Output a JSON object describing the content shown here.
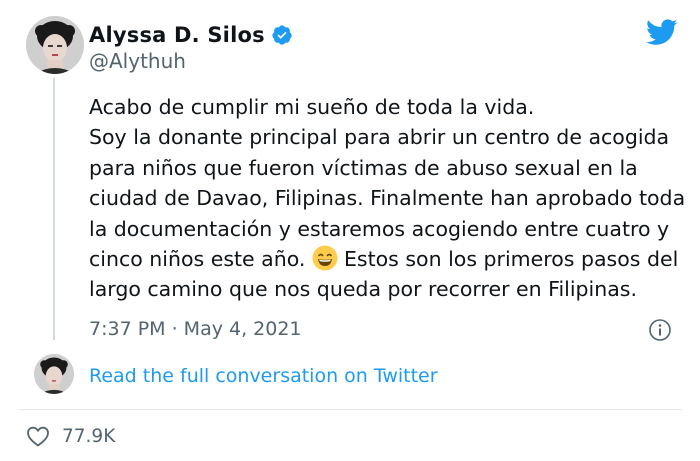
{
  "author": {
    "name": "Alyssa D. Silos",
    "handle": "@Alythuh",
    "verified": true
  },
  "tweet": {
    "text_before_emoji": "Acabo de cumplir mi sueño de toda la vida.\nSoy la donante principal para abrir un centro de acogida para niños que fueron víctimas de abuso sexual en la ciudad de Davao, Filipinas. Finalmente han aprobado toda la documentación y estaremos acogiendo entre cuatro y cinco niños este año.",
    "text_after_emoji": "Estos son los primeros pasos del largo camino que nos queda por recorrer en Filipinas.",
    "emoji": "grinning-face-with-smiling-eyes",
    "timestamp": "7:37 PM · May 4, 2021"
  },
  "conversation_link": "Read the full conversation on Twitter",
  "likes": "77.9K",
  "icons": {
    "brand": "twitter-bird-icon",
    "verified": "verified-badge-icon",
    "info": "info-icon",
    "like": "heart-icon"
  },
  "colors": {
    "brand": "#1d9bf0",
    "text": "#0f1419",
    "secondary": "#536471"
  }
}
